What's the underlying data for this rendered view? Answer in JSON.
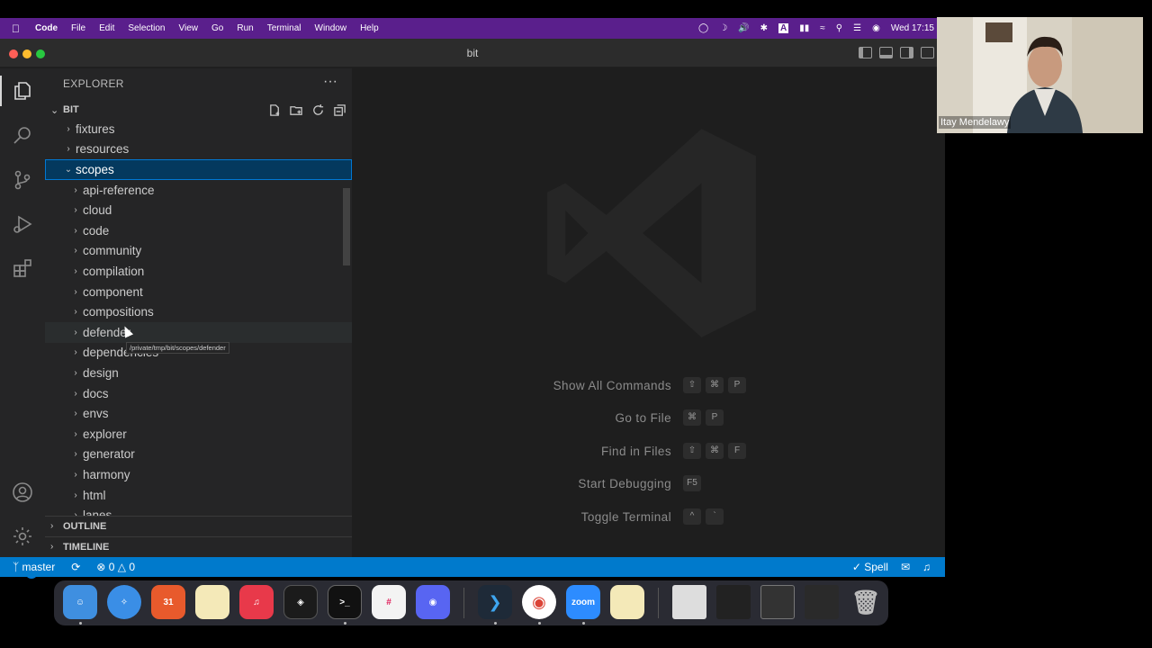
{
  "menubar": {
    "app": "Code",
    "items": [
      "File",
      "Edit",
      "Selection",
      "View",
      "Go",
      "Run",
      "Terminal",
      "Window",
      "Help"
    ],
    "clock": "Wed  17:15"
  },
  "window": {
    "title": "bit"
  },
  "sidebar": {
    "title": "EXPLORER",
    "root_label": "BIT",
    "tree": [
      {
        "label": "fixtures",
        "depth": 0,
        "expanded": false
      },
      {
        "label": "resources",
        "depth": 0,
        "expanded": false
      },
      {
        "label": "scopes",
        "depth": 0,
        "expanded": true,
        "selected": true
      },
      {
        "label": "api-reference",
        "depth": 1
      },
      {
        "label": "cloud",
        "depth": 1
      },
      {
        "label": "code",
        "depth": 1
      },
      {
        "label": "community",
        "depth": 1
      },
      {
        "label": "compilation",
        "depth": 1
      },
      {
        "label": "component",
        "depth": 1
      },
      {
        "label": "compositions",
        "depth": 1
      },
      {
        "label": "defender",
        "depth": 1,
        "hover": true
      },
      {
        "label": "dependencies",
        "depth": 1
      },
      {
        "label": "design",
        "depth": 1
      },
      {
        "label": "docs",
        "depth": 1
      },
      {
        "label": "envs",
        "depth": 1
      },
      {
        "label": "explorer",
        "depth": 1
      },
      {
        "label": "generator",
        "depth": 1
      },
      {
        "label": "harmony",
        "depth": 1
      },
      {
        "label": "html",
        "depth": 1
      },
      {
        "label": "lanes",
        "depth": 1
      }
    ],
    "tooltip": "/private/tmp/bit/scopes/defender",
    "outline_label": "OUTLINE",
    "timeline_label": "TIMELINE"
  },
  "editor": {
    "shortcuts": [
      {
        "name": "Show All Commands",
        "keys": [
          "⇧",
          "⌘",
          "P"
        ]
      },
      {
        "name": "Go to File",
        "keys": [
          "⌘",
          "P"
        ]
      },
      {
        "name": "Find in Files",
        "keys": [
          "⇧",
          "⌘",
          "F"
        ]
      },
      {
        "name": "Start Debugging",
        "keys": [
          "F5"
        ]
      },
      {
        "name": "Toggle Terminal",
        "keys": [
          "^",
          "`"
        ]
      }
    ]
  },
  "statusbar": {
    "branch": "master",
    "errors": "0",
    "warnings": "0",
    "spell": "Spell"
  },
  "activity": {
    "settings_badge": "1"
  },
  "dock": {
    "calendar_day": "31",
    "zoom_label": "zoom"
  },
  "webcam": {
    "name": "Itay Mendelawy"
  },
  "colors": {
    "menubar": "#5a1f8c",
    "statusbar": "#007acc",
    "selection": "#04395e",
    "accent": "#0078d4"
  }
}
